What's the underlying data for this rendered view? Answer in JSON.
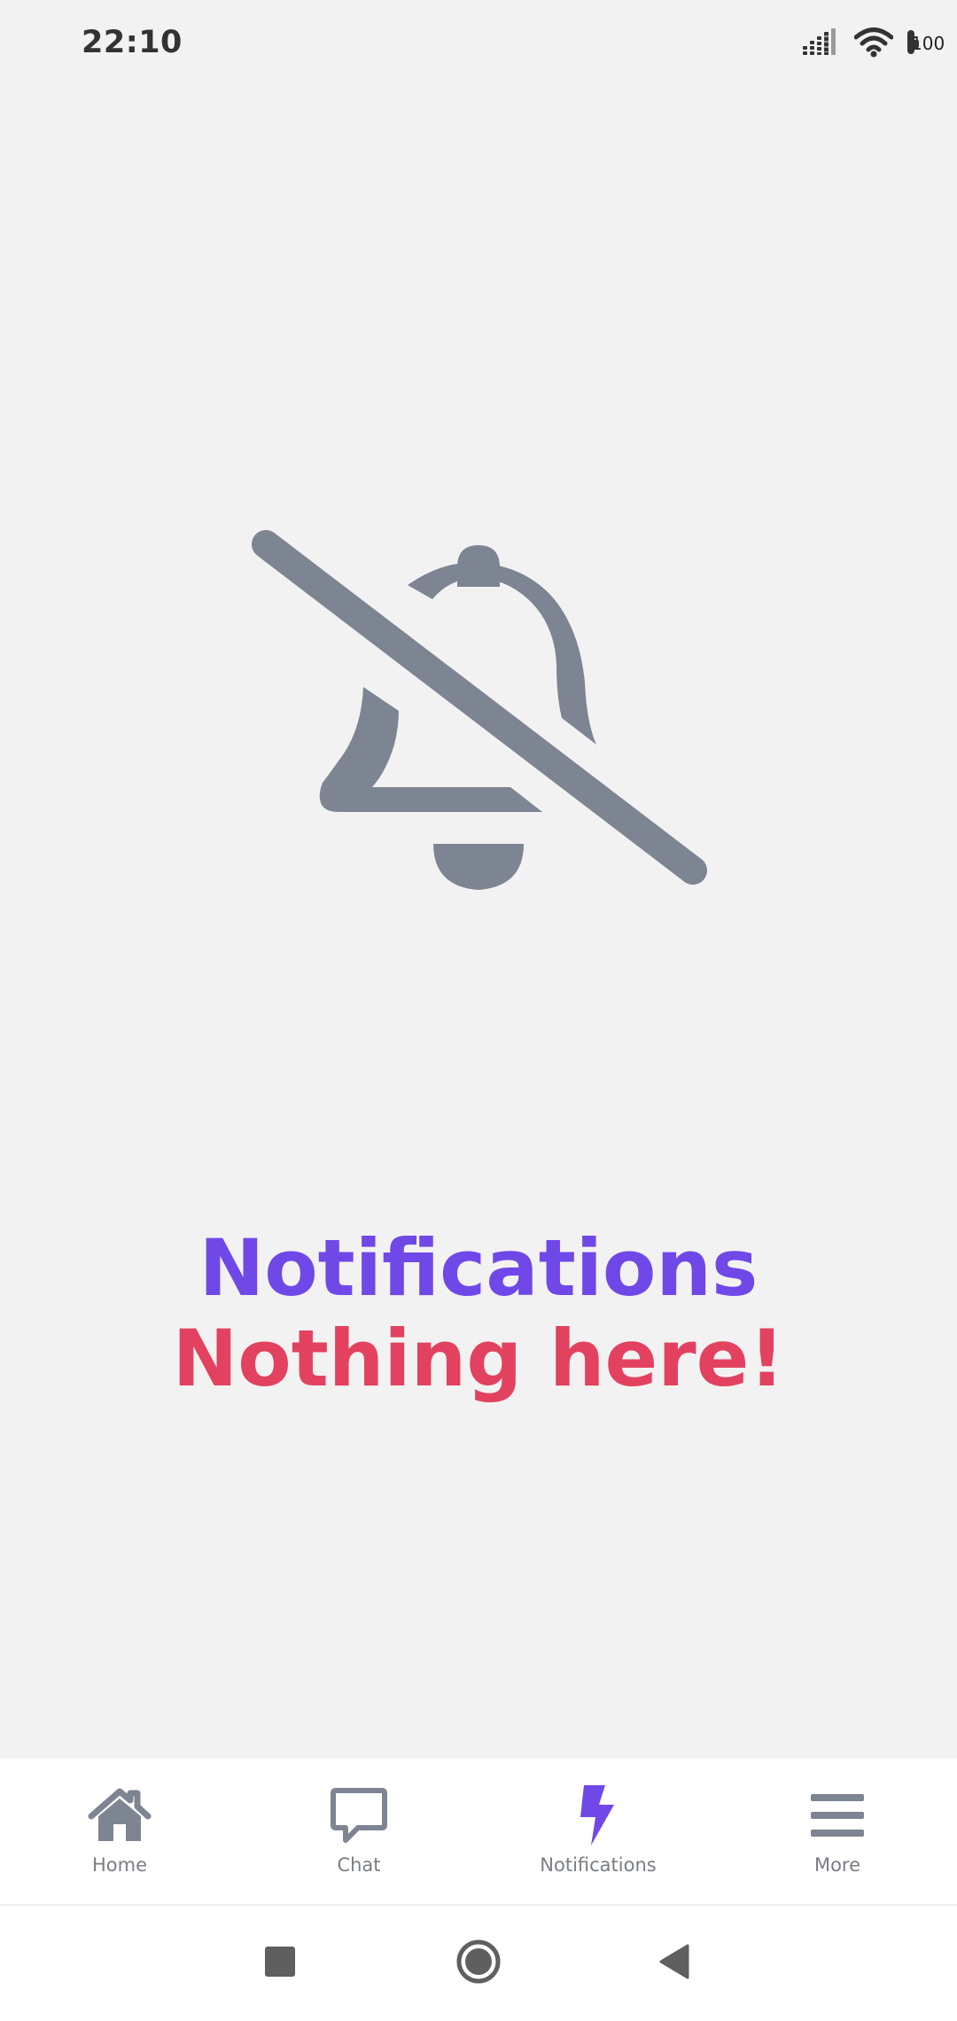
{
  "status_bar": {
    "time": "22:10",
    "battery_level": "100",
    "battery_fill_color": "#6cc644",
    "icons": [
      "signal-icon",
      "wifi-icon",
      "battery-icon"
    ]
  },
  "empty_state": {
    "icon": "bell-off-icon",
    "title": "Notifications",
    "message": "Nothing here!"
  },
  "bottom_nav": {
    "items": [
      {
        "label": "Home",
        "icon": "home-icon",
        "active": false
      },
      {
        "label": "Chat",
        "icon": "chat-icon",
        "active": false
      },
      {
        "label": "Notifications",
        "icon": "lightning-icon",
        "active": true
      },
      {
        "label": "More",
        "icon": "menu-icon",
        "active": false
      }
    ]
  },
  "system_nav": {
    "buttons": [
      "recents-button",
      "home-button",
      "back-button"
    ]
  },
  "colors": {
    "background": "#f2f2f2",
    "surface": "#ffffff",
    "accent_purple": "#7048e8",
    "accent_red": "#e2425f",
    "icon_gray": "#7d8492",
    "label_gray": "#7a7d85",
    "status_dark": "#333333",
    "system_nav_gray": "#5f5f5f"
  }
}
